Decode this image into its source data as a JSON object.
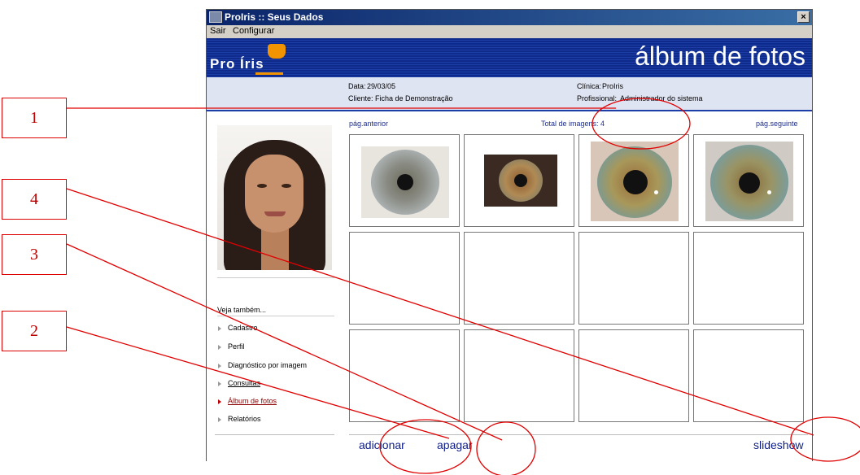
{
  "window": {
    "title": "ProIris :: Seus Dados",
    "menu": [
      "Sair",
      "Configurar"
    ]
  },
  "banner": {
    "logo": "Pro Íris",
    "page_title": "álbum de fotos"
  },
  "info": {
    "data_label": "Data:",
    "data_value": "29/03/05",
    "cliente_label": "Cliente:",
    "cliente_value": "Ficha de Demonstração",
    "clinica_label": "Clínica:",
    "clinica_value": "ProIris",
    "profissional_label": "Profissional:",
    "profissional_value": "Administrador do sistema"
  },
  "album": {
    "prev_label": "pág.anterior",
    "total_label": "Total de imagens: 4",
    "next_label": "pág.seguinte"
  },
  "sidebar": {
    "see_also": "Veja também...",
    "items": [
      {
        "label": "Cadastro"
      },
      {
        "label": "Perfil"
      },
      {
        "label": "Diagnóstico por imagem"
      },
      {
        "label": "Consultas"
      },
      {
        "label": "Álbum de fotos",
        "active": true
      },
      {
        "label": "Relatórios"
      }
    ]
  },
  "actions": {
    "add": "adicionar",
    "delete": "apagar",
    "slideshow": "slideshow"
  },
  "annotations": [
    "1",
    "4",
    "3",
    "2"
  ],
  "colors": {
    "banner": "#0e2a8a",
    "accent": "#f29300",
    "annotation": "#d00000",
    "link": "#1c2e8c"
  }
}
